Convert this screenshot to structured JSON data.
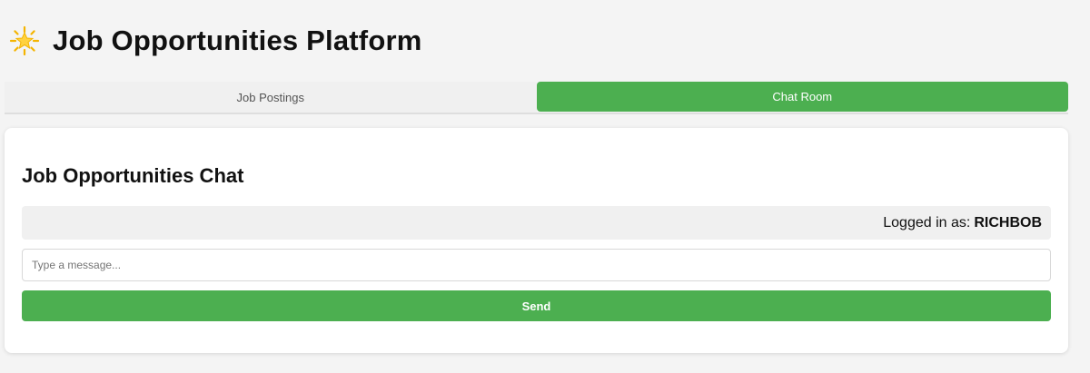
{
  "header": {
    "logo_icon": "glowing-star-icon",
    "title": "Job Opportunities Platform"
  },
  "tabs": [
    {
      "label": "Job Postings",
      "active": false
    },
    {
      "label": "Chat Room",
      "active": true
    }
  ],
  "chat": {
    "title": "Job Opportunities Chat",
    "logged_in_prefix": "Logged in as:",
    "username": "RICHBOB",
    "input_placeholder": "Type a message...",
    "input_value": "",
    "send_label": "Send"
  },
  "colors": {
    "accent": "#4caf50",
    "background": "#f4f4f4",
    "card": "#ffffff",
    "tab_inactive": "#f0f0f0",
    "user_bar": "#f0f0f0"
  }
}
